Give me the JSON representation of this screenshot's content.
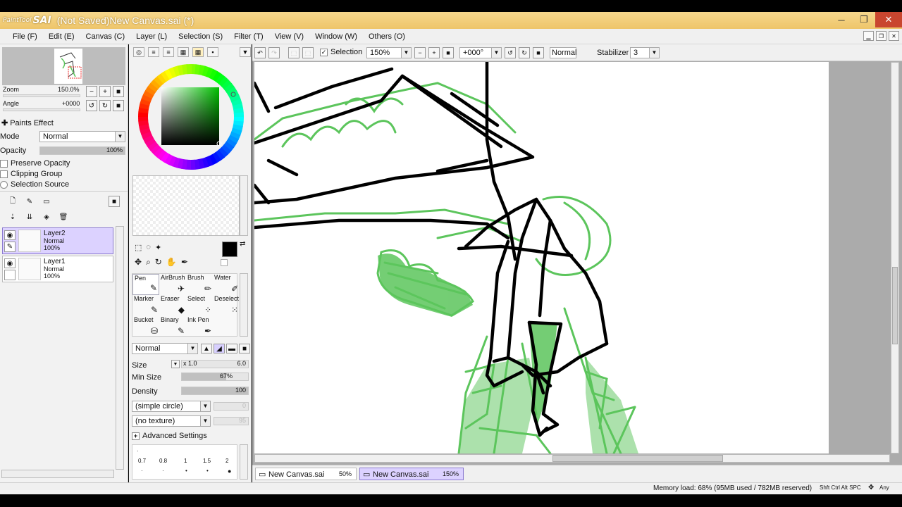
{
  "app": {
    "logo_small": "PaintTool",
    "logo_big": "SAI",
    "window_title": "(Not Saved)New Canvas.sai (*)",
    "win_minimize": "─",
    "win_maximize": "❐",
    "win_close": "✕"
  },
  "menu": [
    "File (F)",
    "Edit (E)",
    "Canvas (C)",
    "Layer (L)",
    "Selection (S)",
    "Filter (T)",
    "View (V)",
    "Window (W)",
    "Others (O)"
  ],
  "navigator": {
    "zoom_label": "Zoom",
    "zoom_value": "150.0%",
    "angle_label": "Angle",
    "angle_value": "+0000"
  },
  "layer_props": {
    "section_label": "Paints Effect",
    "mode_label": "Mode",
    "mode_value": "Normal",
    "opacity_label": "Opacity",
    "opacity_value": "100%",
    "opacity_level": 1.0,
    "preserve_opacity": "Preserve Opacity",
    "clipping_group": "Clipping Group",
    "selection_source": "Selection Source"
  },
  "layers": [
    {
      "name": "Layer2",
      "mode": "Normal",
      "opacity": "100%",
      "selected": true
    },
    {
      "name": "Layer1",
      "mode": "Normal",
      "opacity": "100%",
      "selected": false
    }
  ],
  "tools": {
    "row1": [
      "Pen",
      "AirBrush",
      "Brush",
      "Water"
    ],
    "row2": [
      "Marker",
      "Eraser",
      "Select",
      "Deselect"
    ],
    "row3": [
      "Bucket",
      "Binary",
      "Ink Pen"
    ],
    "selected": "Pen"
  },
  "brush": {
    "blend_mode": "Normal",
    "size_label": "Size",
    "size_mult": "x 1.0",
    "size_value": "6.0",
    "min_size_label": "Min Size",
    "min_size_value": "67%",
    "min_size_level": 0.67,
    "density_label": "Density",
    "density_value": "100",
    "density_level": 1.0,
    "shape": "(simple circle)",
    "shape_amount": "0",
    "texture": "(no texture)",
    "texture_amount": "95",
    "advanced": "Advanced Settings",
    "size_presets": [
      "0.7",
      "0.8",
      "1",
      "1.5",
      "2"
    ]
  },
  "canvas_toolbar": {
    "selection_label": "Selection",
    "zoom": "150%",
    "angle": "+000°",
    "blend": "Normal",
    "stabilizer_label": "Stabilizer",
    "stabilizer_value": "3"
  },
  "canvas_tabs": [
    {
      "name": "New Canvas.sai",
      "zoom": "50%",
      "active": false
    },
    {
      "name": "New Canvas.sai",
      "zoom": "150%",
      "active": true
    }
  ],
  "status": {
    "memory": "Memory load: 68% (95MB used / 782MB reserved)",
    "keys": "Shft Ctrl Alt SPC",
    "any": "Any"
  },
  "colors": {
    "accent": "#dcd2ff",
    "sketch_green": "#5cc55c",
    "ink": "#000000",
    "titlebar": "#f0c870"
  }
}
